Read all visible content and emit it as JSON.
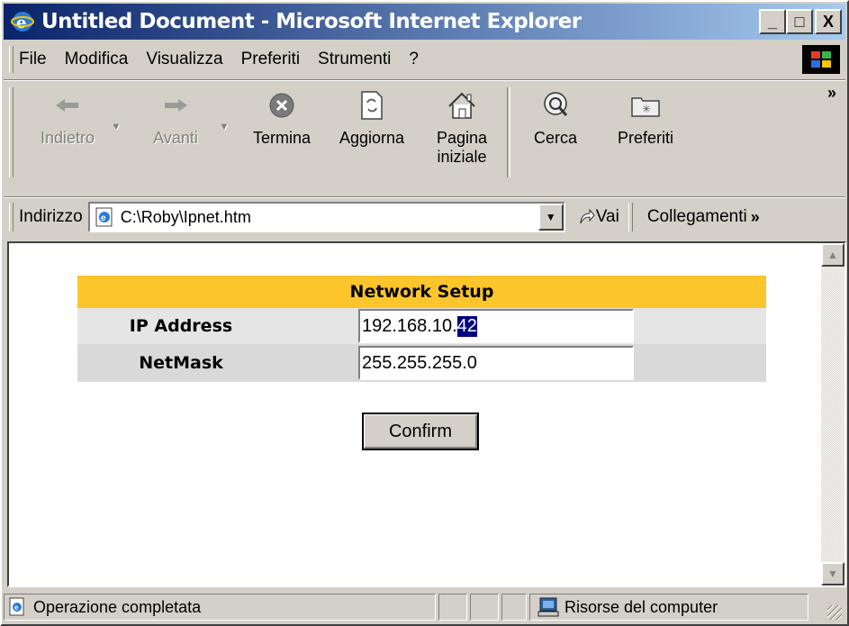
{
  "window": {
    "title": "Untitled Document - Microsoft Internet Explorer",
    "minimize": "_",
    "maximize": "□",
    "close": "X"
  },
  "menu": [
    {
      "label": "File"
    },
    {
      "label": "Modifica"
    },
    {
      "label": "Visualizza"
    },
    {
      "label": "Preferiti"
    },
    {
      "label": "Strumenti"
    },
    {
      "label": "?"
    }
  ],
  "toolbar": {
    "back": "Indietro",
    "forward": "Avanti",
    "stop": "Termina",
    "refresh": "Aggiorna",
    "home_line1": "Pagina",
    "home_line2": "iniziale",
    "search": "Cerca",
    "favorites": "Preferiti",
    "more": "»"
  },
  "address": {
    "label": "Indirizzo",
    "value": "C:\\Roby\\Ipnet.htm",
    "go": "Vai",
    "links": "Collegamenti",
    "links_more": "»"
  },
  "form": {
    "title": "Network Setup",
    "ip_label": "IP Address",
    "ip_value_prefix": "192.168.10.",
    "ip_value_selected": "42",
    "netmask_label": "NetMask",
    "netmask_value": "255.255.255.0",
    "confirm": "Confirm"
  },
  "status": {
    "text": "Operazione completata",
    "zone": "Risorse del computer"
  },
  "colors": {
    "title_gradient_start": "#0a246a",
    "title_gradient_end": "#a6caf0",
    "form_header": "#fcc52c",
    "selection": "#000080"
  }
}
